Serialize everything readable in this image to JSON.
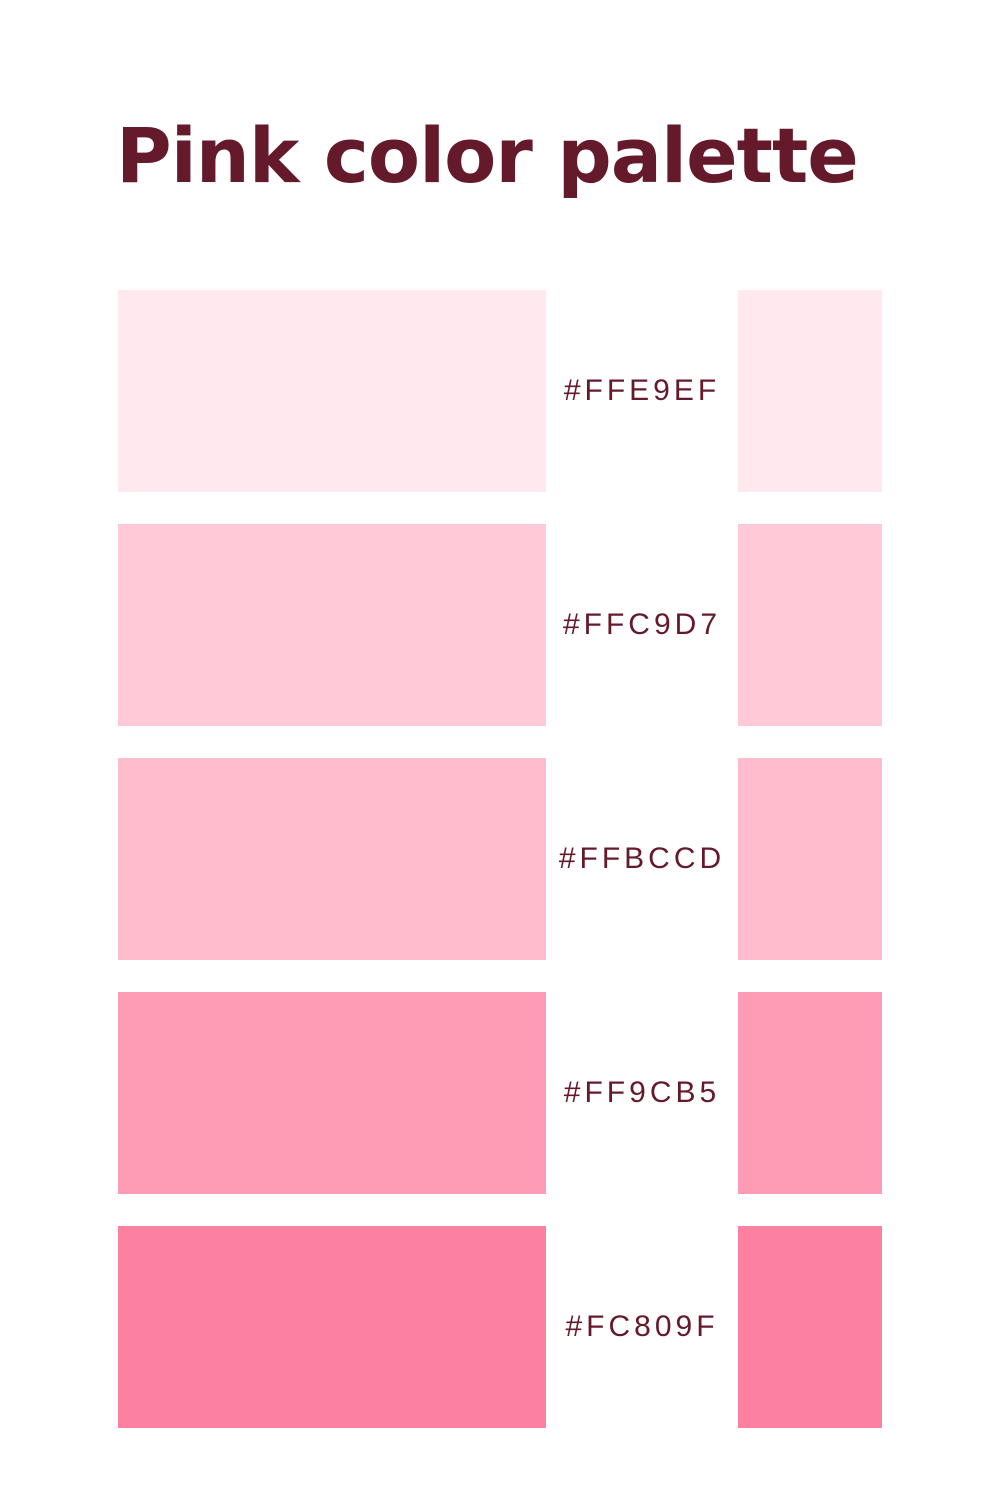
{
  "title": "Pink color palette",
  "text_color": "#651A2C",
  "swatches": [
    {
      "hex": "#FFE9EF",
      "label": "#FFE9EF"
    },
    {
      "hex": "#FFC9D7",
      "label": "#FFC9D7"
    },
    {
      "hex": "#FFBCCD",
      "label": "#FFBCCD"
    },
    {
      "hex": "#FF9CB5",
      "label": "#FF9CB5"
    },
    {
      "hex": "#FC809F",
      "label": "#FC809F"
    }
  ]
}
